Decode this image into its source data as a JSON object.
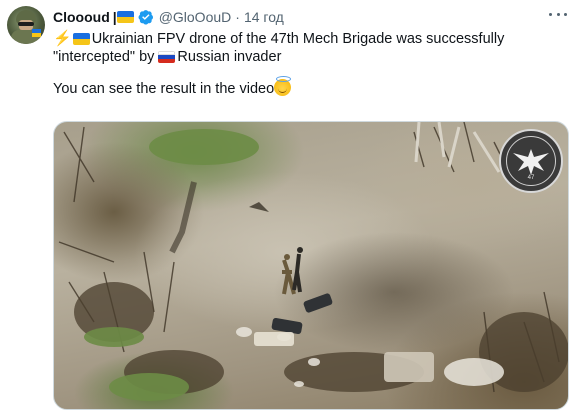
{
  "tweet": {
    "author_name": "Clooоud",
    "name_separator": "|",
    "handle": "@GloOouD",
    "time_separator": "·",
    "time": "14 год",
    "text_line1": "Ukrainian FPV drone of the 47th Mech Brigade was successfully",
    "text_line2_a": "\"intercepted\" by ",
    "text_line2_b": "Russian invader",
    "text_line3": "You can see the result in the video",
    "bolt": "⚡"
  },
  "icons": {
    "ukraine_flag": [
      "#1a6fe0",
      "#f5c518"
    ],
    "russia_flag": [
      "#ffffff",
      "#1c49c2",
      "#d52b1e"
    ],
    "verified_color": "#1d9bf0"
  },
  "media": {
    "emblem_number": "47"
  }
}
